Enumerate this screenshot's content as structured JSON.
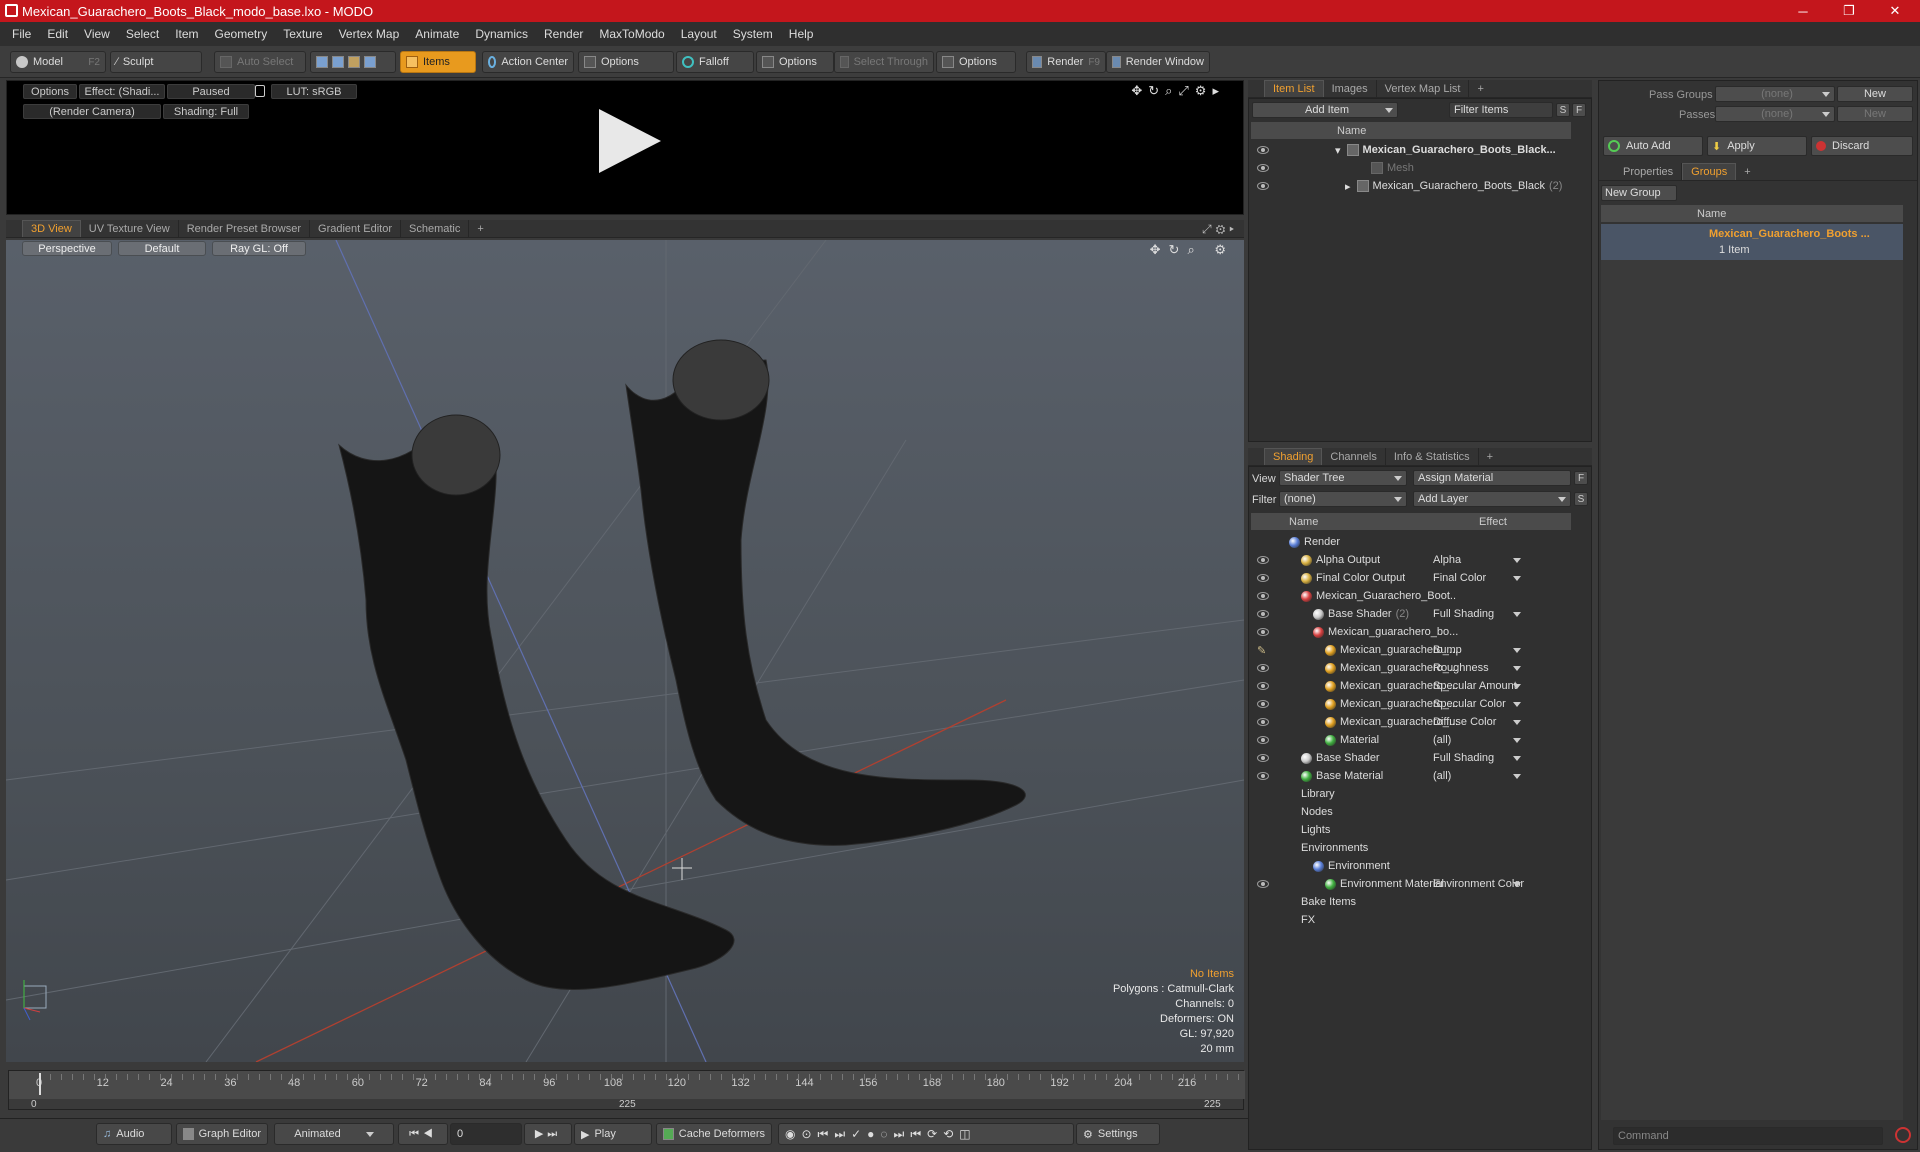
{
  "window": {
    "title": "Mexican_Guarachero_Boots_Black_modo_base.lxo - MODO",
    "minimize": "─",
    "maximize": "❐",
    "close": "✕"
  },
  "menu": [
    "File",
    "Edit",
    "View",
    "Select",
    "Item",
    "Geometry",
    "Texture",
    "Vertex Map",
    "Animate",
    "Dynamics",
    "Render",
    "MaxToModo",
    "Layout",
    "System",
    "Help"
  ],
  "toolbar": {
    "model": "Model",
    "model_key": "F2",
    "sculpt": "Sculpt",
    "auto_select": "Auto Select",
    "items": "Items",
    "action_center": "Action Center",
    "options1": "Options",
    "falloff": "Falloff",
    "options2": "Options",
    "select_through": "Select Through",
    "options3": "Options",
    "render": "Render",
    "render_key": "F9",
    "render_window": "Render Window"
  },
  "preview": {
    "options": "Options",
    "effect": "Effect: (Shadi...",
    "paused": "Paused",
    "lut": "LUT: sRGB",
    "camera": "(Render Camera)",
    "shading": "Shading: Full"
  },
  "viewtabs": [
    "3D View",
    "UV Texture View",
    "Render Preset Browser",
    "Gradient Editor",
    "Schematic",
    "+"
  ],
  "viewport": {
    "projection": "Perspective",
    "style": "Default",
    "raygl": "Ray GL: Off"
  },
  "stats": {
    "items": "No Items",
    "polygons": "Polygons : Catmull-Clark",
    "channels": "Channels: 0",
    "deformers": "Deformers: ON",
    "gl": "GL: 97,920",
    "unit": "20 mm"
  },
  "timeline": {
    "ticks": [
      "0",
      "12",
      "24",
      "36",
      "48",
      "60",
      "72",
      "84",
      "96",
      "108",
      "120",
      "132",
      "144",
      "156",
      "168",
      "180",
      "192",
      "204",
      "216"
    ],
    "range_start": "0",
    "range_mid": "225",
    "range_end": "225"
  },
  "bottombar": {
    "audio": "Audio",
    "graph_editor": "Graph Editor",
    "animated": "Animated",
    "frame": "0",
    "play": "Play",
    "cache": "Cache Deformers",
    "settings": "Settings"
  },
  "itemlist": {
    "tabs": [
      "Item List",
      "Images",
      "Vertex Map List",
      "+"
    ],
    "add_item": "Add Item",
    "filter": "Filter Items",
    "s": "S",
    "f": "F",
    "col_name": "Name",
    "rows": [
      {
        "label": "Mexican_Guarachero_Boots_Black...",
        "bold": true
      },
      {
        "label": "Mesh",
        "dim": true
      },
      {
        "label": "Mexican_Guarachero_Boots_Black",
        "count": "(2)"
      }
    ]
  },
  "shading": {
    "tabs": [
      "Shading",
      "Channels",
      "Info & Statistics",
      "+"
    ],
    "view_label": "View",
    "view_value": "Shader Tree",
    "assign": "Assign Material",
    "f": "F",
    "filter_label": "Filter",
    "filter_value": "(none)",
    "add_layer": "Add Layer",
    "s": "S",
    "col_name": "Name",
    "col_effect": "Effect",
    "rows": [
      {
        "name": "Render",
        "effect": "",
        "indent": 0,
        "eye": false,
        "color": "#5a7fd8"
      },
      {
        "name": "Alpha Output",
        "effect": "Alpha",
        "indent": 1,
        "eye": true,
        "color": "#d8b040"
      },
      {
        "name": "Final Color Output",
        "effect": "Final Color",
        "indent": 1,
        "eye": true,
        "color": "#d8b040"
      },
      {
        "name": "Mexican_Guarachero_Boot...",
        "effect": "",
        "indent": 1,
        "eye": true,
        "color": "#d84040"
      },
      {
        "name": "Base Shader",
        "count": "(2)",
        "effect": "Full Shading",
        "indent": 2,
        "eye": true,
        "color": "#cccccc"
      },
      {
        "name": "Mexican_guarachero_bo...",
        "effect": "",
        "indent": 2,
        "eye": true,
        "color": "#d84040"
      },
      {
        "name": "Mexican_guarachero_...",
        "effect": "Bump",
        "indent": 3,
        "eye": false,
        "brush": true,
        "color": "#e0a020"
      },
      {
        "name": "Mexican_guarachero_...",
        "effect": "Roughness",
        "indent": 3,
        "eye": true,
        "color": "#e0a020"
      },
      {
        "name": "Mexican_guarachero_...",
        "effect": "Specular Amount",
        "indent": 3,
        "eye": true,
        "color": "#e0a020"
      },
      {
        "name": "Mexican_guarachero_...",
        "effect": "Specular Color",
        "indent": 3,
        "eye": true,
        "color": "#e0a020"
      },
      {
        "name": "Mexican_guarachero_...",
        "effect": "Diffuse Color",
        "indent": 3,
        "eye": true,
        "color": "#e0a020"
      },
      {
        "name": "Material",
        "effect": "(all)",
        "indent": 3,
        "eye": true,
        "color": "#40b040"
      },
      {
        "name": "Base Shader",
        "effect": "Full Shading",
        "indent": 1,
        "eye": true,
        "color": "#cccccc"
      },
      {
        "name": "Base Material",
        "effect": "(all)",
        "indent": 1,
        "eye": true,
        "color": "#40b040"
      },
      {
        "name": "Library",
        "effect": "",
        "indent": 1,
        "eye": false,
        "color": ""
      },
      {
        "name": "Nodes",
        "effect": "",
        "indent": 1,
        "eye": false,
        "color": ""
      },
      {
        "name": "Lights",
        "effect": "",
        "indent": 1,
        "eye": false,
        "color": ""
      },
      {
        "name": "Environments",
        "effect": "",
        "indent": 1,
        "eye": false,
        "color": ""
      },
      {
        "name": "Environment",
        "effect": "",
        "indent": 2,
        "eye": false,
        "color": "#5a7fd8"
      },
      {
        "name": "Environment Material",
        "effect": "Environment Color",
        "indent": 3,
        "eye": true,
        "color": "#40b040"
      },
      {
        "name": "Bake Items",
        "effect": "",
        "indent": 1,
        "eye": false,
        "color": ""
      },
      {
        "name": "FX",
        "effect": "",
        "indent": 1,
        "eye": false,
        "color": ""
      }
    ]
  },
  "groups": {
    "pass_groups_label": "Pass Groups",
    "pass_groups_value": "(none)",
    "new1": "New",
    "passes_label": "Passes",
    "passes_value": "(none)",
    "new2": "New",
    "auto_add": "Auto Add",
    "apply": "Apply",
    "discard": "Discard",
    "tabs": [
      "Properties",
      "Groups",
      "+"
    ],
    "new_group": "New Group",
    "col_name": "Name",
    "group_name": "Mexican_Guarachero_Boots ...",
    "group_count": "1 Item"
  },
  "command": {
    "placeholder": "Command"
  },
  "colors": {
    "accent": "#f0a030",
    "title": "#c4161c"
  }
}
